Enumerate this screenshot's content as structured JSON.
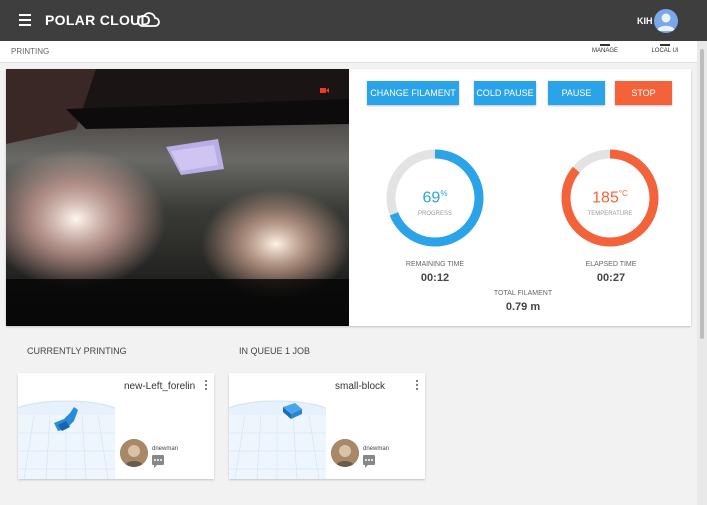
{
  "app": {
    "logo_text": "POLAR CLOUD",
    "user_initials": "KIH"
  },
  "subbar": {
    "breadcrumb": "PRINTING",
    "manage_label": "MANAGE",
    "local_ui_label": "LOCAL UI"
  },
  "controls": {
    "change_filament": "CHANGE FILAMENT",
    "cold_pause": "COLD PAUSE",
    "pause": "PAUSE",
    "stop": "STOP"
  },
  "progress": {
    "value": "69",
    "unit": "%",
    "label": "PROGRESS",
    "fraction": 0.69
  },
  "temperature": {
    "value": "185",
    "unit": "°C",
    "label": "TEMPERATURE",
    "fraction": 0.86
  },
  "stats": {
    "remaining_label": "REMAINING TIME",
    "remaining_value": "00:12",
    "elapsed_label": "ELAPSED TIME",
    "elapsed_value": "00:27",
    "filament_label": "TOTAL FILAMENT",
    "filament_value": "0.79 m"
  },
  "sections": {
    "currently_printing": "CURRENTLY PRINTING",
    "in_queue": "IN QUEUE 1 JOB"
  },
  "jobs": [
    {
      "name": "new-Left_forelin",
      "owner": "dnewman"
    },
    {
      "name": "small-block",
      "owner": "dnewman"
    }
  ],
  "colors": {
    "accent_blue": "#2aa3e8",
    "stop_red": "#f4623a",
    "temp_orange": "#f4623a",
    "header_bg": "#3e3e3e"
  }
}
